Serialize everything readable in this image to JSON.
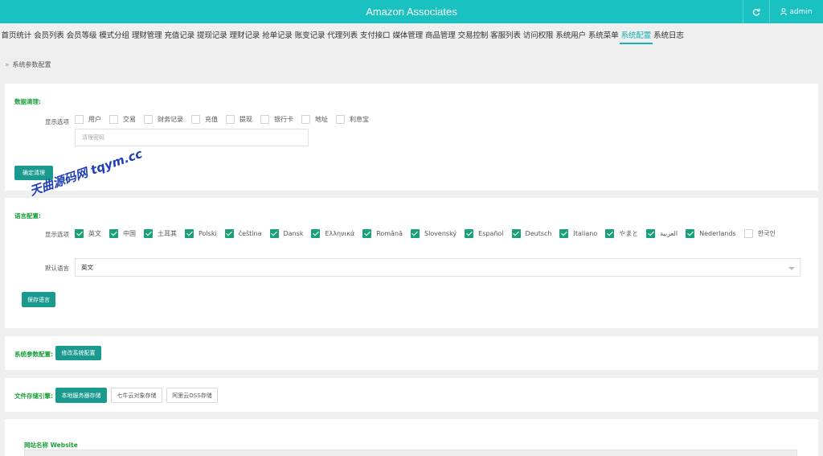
{
  "header": {
    "title": "Amazon Associates",
    "user": "admin",
    "refresh_icon": "refresh-icon",
    "user_icon": "user-icon",
    "bg_color": "#19c2c0"
  },
  "nav": {
    "active_index": 19,
    "items": [
      "首页统计",
      "会员列表",
      "会员等级",
      "模式分组",
      "理财管理",
      "充值记录",
      "提现记录",
      "理财记录",
      "抢单记录",
      "账变记录",
      "代理列表",
      "支付接口",
      "媒体管理",
      "商品管理",
      "交易控制",
      "客服列表",
      "访问权限",
      "系统用户",
      "系统菜单",
      "系统配置",
      "系统日志"
    ]
  },
  "breadcrumb": {
    "arrow": "»",
    "label": "系统参数配置"
  },
  "data_clean": {
    "section_label": "数据清理:",
    "options_label": "显示选项",
    "options": [
      "用户",
      "交易",
      "财务记录",
      "充值",
      "提现",
      "银行卡",
      "地址",
      "利息宝"
    ],
    "password_placeholder": "清理密码",
    "confirm_button": "确定清理"
  },
  "language": {
    "section_label": "语言配置:",
    "options_label": "显示选项",
    "options": [
      {
        "label": "英文",
        "checked": true
      },
      {
        "label": "中国",
        "checked": true
      },
      {
        "label": "土耳其",
        "checked": true
      },
      {
        "label": "Polski",
        "checked": true
      },
      {
        "label": "čeština",
        "checked": true
      },
      {
        "label": "Dansk",
        "checked": true
      },
      {
        "label": "Ελληνικά",
        "checked": true
      },
      {
        "label": "Română",
        "checked": true
      },
      {
        "label": "Slovenský",
        "checked": true
      },
      {
        "label": "Español",
        "checked": true
      },
      {
        "label": "Deutsch",
        "checked": true
      },
      {
        "label": "Italiano",
        "checked": true
      },
      {
        "label": "やまと",
        "checked": true
      },
      {
        "label": "العربية",
        "checked": true
      },
      {
        "label": "Nederlands",
        "checked": true
      },
      {
        "label": "한국인",
        "checked": false
      }
    ],
    "default_label": "默认语言",
    "default_value": "英文",
    "save_button": "保存语言"
  },
  "system_config": {
    "label": "系统参数配置:",
    "button": "修改系统配置"
  },
  "file_storage": {
    "label": "文件存储引擎:",
    "buttons": [
      {
        "label": "本地服务器存储",
        "active": true
      },
      {
        "label": "七牛云对象存储",
        "active": false
      },
      {
        "label": "阿里云OSS存储",
        "active": false
      }
    ]
  },
  "website": {
    "label": "网站名称 Website"
  },
  "watermark": "天曲源码网 tqym.cc"
}
